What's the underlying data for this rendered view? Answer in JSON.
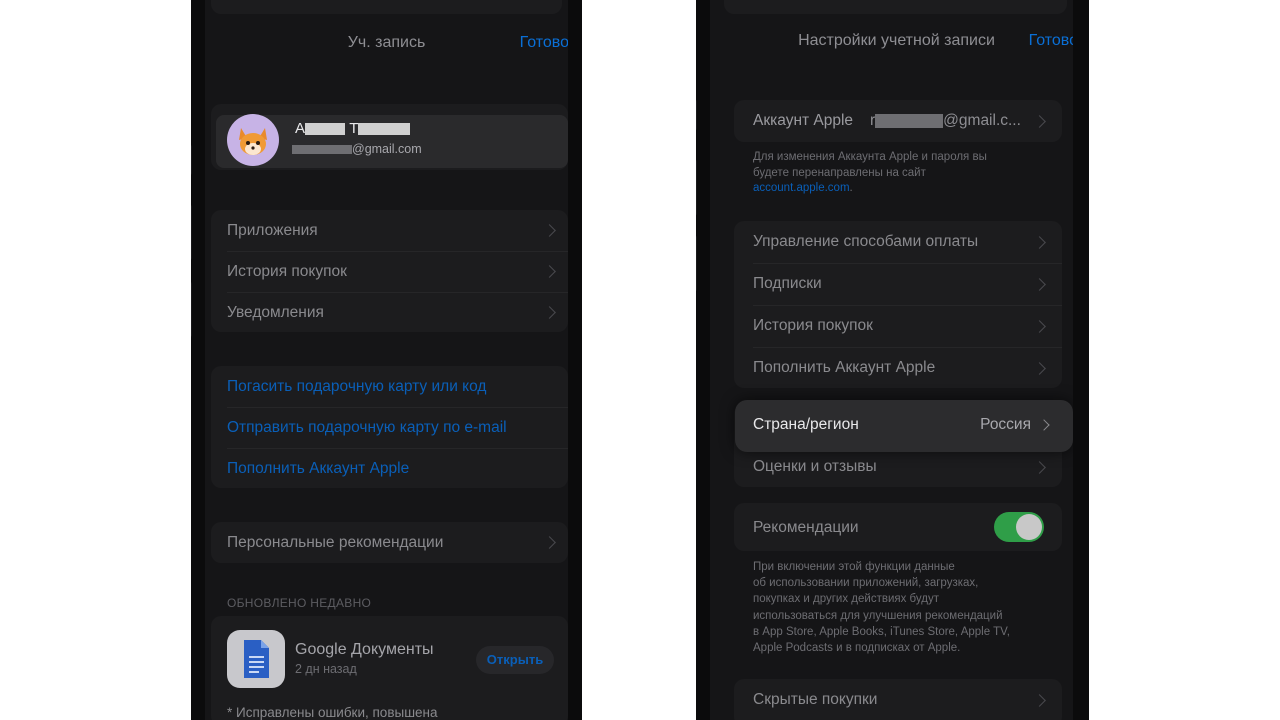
{
  "left": {
    "title": "Уч. запись",
    "done": "Готово",
    "profile": {
      "name_prefix": "А",
      "name_mid": "Т",
      "email_suffix": "@gmail.com",
      "avatar_icon": "fox-memoji-icon"
    },
    "group1": [
      "Приложения",
      "История покупок",
      "Уведомления"
    ],
    "group2": [
      "Погасить подарочную карту или код",
      "Отправить подарочную карту по e-mail",
      "Пополнить Аккаунт Apple"
    ],
    "group3": [
      "Персональные рекомендации"
    ],
    "recent_header": "ОБНОВЛЕНО НЕДАВНО",
    "recent_app": {
      "name": "Google Документы",
      "date": "2 дн назад",
      "button": "Открыть",
      "icon": "google-docs-icon"
    },
    "release_note": "* Исправлены ошибки, повышена"
  },
  "right": {
    "title": "Настройки учетной записи",
    "done": "Готово",
    "apple_account": {
      "label": "Аккаунт Apple",
      "value_prefix": "r",
      "value_suffix": "@gmail.c..."
    },
    "account_note_1": "Для изменения Аккаунта Apple и пароля вы",
    "account_note_2": "будете перенаправлены на сайт",
    "account_note_link": "account.apple.com",
    "account_note_end": ".",
    "payment_group": [
      "Управление способами оплаты",
      "Подписки",
      "История покупок",
      "Пополнить Аккаунт Apple"
    ],
    "country_label": "Страна/регион",
    "country_value": "Россия",
    "ratings_label": "Оценки и отзывы",
    "recommendations_label": "Рекомендации",
    "recommendations_on": true,
    "rec_note": [
      "При включении этой функции данные",
      "об использовании приложений, загрузках,",
      "покупках и других действиях будут",
      "использоваться для улучшения рекомендаций",
      "в App Store, Apple Books, iTunes Store, Apple TV,",
      "Apple Podcasts и в подписках от Apple."
    ],
    "hidden_purchases": "Скрытые покупки"
  },
  "colors": {
    "accent": "#0a6fd6",
    "toggle_on": "#2f9e48",
    "background": "#151517"
  }
}
